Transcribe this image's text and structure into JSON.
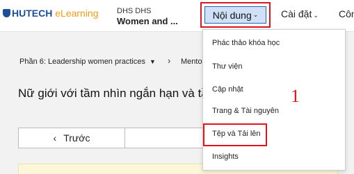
{
  "header": {
    "logo_brand": "HUTECH",
    "logo_suffix": " eLearning",
    "course_org": "DHS DHS",
    "course_title": "Women and ...",
    "nav": {
      "content_label": "Nội dung",
      "settings_label": "Cài đặt",
      "more_label": "Côn"
    }
  },
  "breadcrumb": {
    "section": "Phần 6: Leadership women practices",
    "separator": "›",
    "next": "Mento"
  },
  "unit_title": "Nữ giới với tầm nhìn ngắn hạn và tầ",
  "navigation": {
    "prev_label": "Trước",
    "prev_icon": "‹"
  },
  "dropdown": {
    "items": [
      "Phác thảo khóa học",
      "Thư viện",
      "Cập nhật",
      "Trang & Tài nguyên",
      "Tệp và Tải lên",
      "Insights"
    ]
  },
  "annotation": "1",
  "colors": {
    "highlight_red": "#e0151c",
    "active_bg": "#cfe0f7",
    "brand_blue": "#1b4f9c",
    "brand_orange": "#f39c12"
  }
}
